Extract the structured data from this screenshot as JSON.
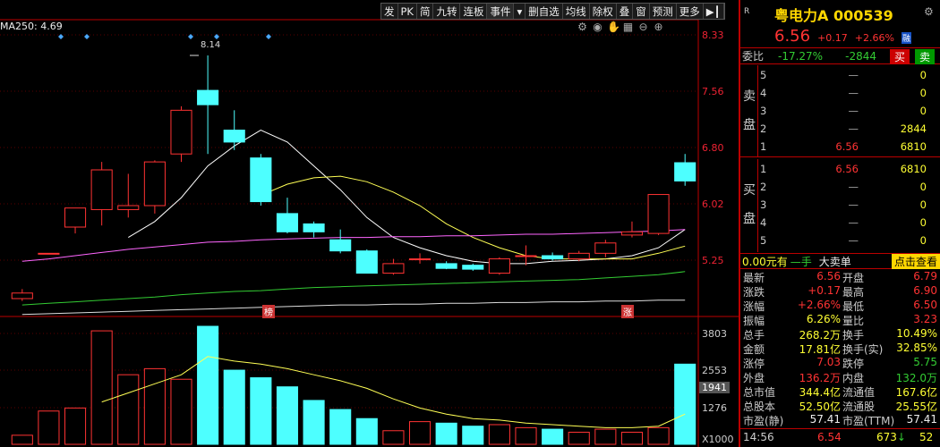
{
  "toolbar": [
    {
      "label": "发",
      "active": false
    },
    {
      "label": "PK",
      "active": false
    },
    {
      "label": "简",
      "active": false
    },
    {
      "label": "九转",
      "active": false
    },
    {
      "label": "连板",
      "active": false
    },
    {
      "label": "事件",
      "active": true
    },
    {
      "label": "▾",
      "active": false
    },
    {
      "label": "删自选",
      "active": false
    },
    {
      "label": "均线",
      "active": false
    },
    {
      "label": "除权",
      "active": false
    },
    {
      "label": "叠",
      "active": false
    },
    {
      "label": "窗",
      "active": false
    },
    {
      "label": "预测",
      "active": false
    },
    {
      "label": "更多",
      "active": false
    },
    {
      "label": "▶┃",
      "active": false
    }
  ],
  "ma_label": "MA250: 4.69",
  "price_axis": [
    "8.33",
    "7.56",
    "6.80",
    "6.02",
    "5.25"
  ],
  "volume_axis": [
    "3803",
    "2553",
    "1276",
    "X1000"
  ],
  "volume_badge": "1941",
  "annotations": {
    "high": "8.14",
    "mark1": "榜",
    "mark2": "涨"
  },
  "colors": {
    "up": "#ff3333",
    "down": "#4dffff",
    "ma5": "#ffffff",
    "ma10": "#ffff55",
    "ma20": "#ff66ff",
    "ma60": "#33cc33",
    "ma250": "#dddddd"
  },
  "chart_data": {
    "type": "candlestick",
    "ylim": [
      4.9,
      8.5
    ],
    "vol_ylim": [
      0,
      3900
    ],
    "candles": [
      {
        "o": 5.08,
        "c": 5.15,
        "h": 5.2,
        "l": 5.05,
        "v": 300
      },
      {
        "o": 5.65,
        "c": 5.65,
        "h": 5.65,
        "l": 5.65,
        "v": 1100
      },
      {
        "o": 5.98,
        "c": 6.22,
        "h": 6.22,
        "l": 5.9,
        "v": 1200
      },
      {
        "o": 6.2,
        "c": 6.7,
        "h": 6.8,
        "l": 6.0,
        "v": 3750
      },
      {
        "o": 6.2,
        "c": 6.25,
        "h": 6.65,
        "l": 6.1,
        "v": 2300
      },
      {
        "o": 6.25,
        "c": 6.8,
        "h": 6.82,
        "l": 6.15,
        "v": 2500
      },
      {
        "o": 6.9,
        "c": 7.45,
        "h": 7.5,
        "l": 6.8,
        "v": 2150
      },
      {
        "o": 7.7,
        "c": 7.52,
        "h": 8.14,
        "l": 6.9,
        "v": 3900
      },
      {
        "o": 7.2,
        "c": 7.05,
        "h": 7.45,
        "l": 6.95,
        "v": 2450
      },
      {
        "o": 6.85,
        "c": 6.3,
        "h": 6.9,
        "l": 6.25,
        "v": 2200
      },
      {
        "o": 6.15,
        "c": 5.92,
        "h": 6.35,
        "l": 5.9,
        "v": 1900
      },
      {
        "o": 6.02,
        "c": 5.92,
        "h": 6.05,
        "l": 5.85,
        "v": 1450
      },
      {
        "o": 5.82,
        "c": 5.68,
        "h": 5.95,
        "l": 5.65,
        "v": 1150
      },
      {
        "o": 5.68,
        "c": 5.4,
        "h": 5.7,
        "l": 5.4,
        "v": 850
      },
      {
        "o": 5.4,
        "c": 5.52,
        "h": 5.58,
        "l": 5.38,
        "v": 450
      },
      {
        "o": 5.58,
        "c": 5.58,
        "h": 5.65,
        "l": 5.52,
        "v": 750
      },
      {
        "o": 5.52,
        "c": 5.46,
        "h": 5.55,
        "l": 5.45,
        "v": 700
      },
      {
        "o": 5.5,
        "c": 5.45,
        "h": 5.52,
        "l": 5.43,
        "v": 600
      },
      {
        "o": 5.4,
        "c": 5.58,
        "h": 5.6,
        "l": 5.38,
        "v": 650
      },
      {
        "o": 5.62,
        "c": 5.62,
        "h": 5.75,
        "l": 5.5,
        "v": 550
      },
      {
        "o": 5.62,
        "c": 5.58,
        "h": 5.66,
        "l": 5.56,
        "v": 500
      },
      {
        "o": 5.58,
        "c": 5.65,
        "h": 5.68,
        "l": 5.55,
        "v": 400
      },
      {
        "o": 5.65,
        "c": 5.78,
        "h": 5.82,
        "l": 5.6,
        "v": 500
      },
      {
        "o": 5.88,
        "c": 5.92,
        "h": 6.05,
        "l": 5.85,
        "v": 400
      },
      {
        "o": 5.9,
        "c": 6.39,
        "h": 6.39,
        "l": 5.88,
        "v": 550
      },
      {
        "o": 6.79,
        "c": 6.56,
        "h": 6.9,
        "l": 6.5,
        "v": 2650
      }
    ],
    "ma_series": [
      {
        "key": "ma5",
        "values": [
          null,
          null,
          null,
          null,
          5.85,
          6.05,
          6.35,
          6.75,
          7.0,
          7.2,
          7.05,
          6.75,
          6.45,
          6.1,
          5.85,
          5.72,
          5.62,
          5.55,
          5.52,
          5.52,
          5.55,
          5.56,
          5.58,
          5.62,
          5.72,
          5.95
        ]
      },
      {
        "key": "ma10",
        "values": [
          null,
          null,
          null,
          null,
          null,
          null,
          null,
          null,
          null,
          6.38,
          6.52,
          6.6,
          6.62,
          6.55,
          6.42,
          6.25,
          6.02,
          5.85,
          5.72,
          5.62,
          5.58,
          5.58,
          5.58,
          5.58,
          5.65,
          5.74
        ]
      },
      {
        "key": "ma20",
        "values": [
          5.55,
          5.58,
          5.62,
          5.66,
          5.7,
          5.73,
          5.76,
          5.79,
          5.8,
          5.82,
          5.83,
          5.84,
          5.85,
          5.85,
          5.86,
          5.86,
          5.87,
          5.87,
          5.88,
          5.89,
          5.89,
          5.9,
          5.91,
          5.92,
          5.93,
          5.95
        ]
      },
      {
        "key": "ma60",
        "values": [
          5.0,
          5.02,
          5.04,
          5.06,
          5.08,
          5.1,
          5.13,
          5.15,
          5.17,
          5.18,
          5.2,
          5.22,
          5.23,
          5.24,
          5.25,
          5.26,
          5.27,
          5.28,
          5.29,
          5.3,
          5.31,
          5.32,
          5.34,
          5.36,
          5.38,
          5.42
        ]
      },
      {
        "key": "ma250",
        "values": [
          4.88,
          4.89,
          4.9,
          4.91,
          4.92,
          4.93,
          4.94,
          4.95,
          4.96,
          4.97,
          4.98,
          4.99,
          5.0,
          5.0,
          5.01,
          5.01,
          5.02,
          5.02,
          5.03,
          5.03,
          5.04,
          5.04,
          5.05,
          5.05,
          5.06,
          5.06
        ]
      }
    ],
    "vol_ma": [
      null,
      null,
      null,
      1400,
      1700,
      2000,
      2300,
      2900,
      2750,
      2650,
      2500,
      2300,
      2100,
      1850,
      1500,
      1200,
      1000,
      850,
      800,
      700,
      650,
      600,
      550,
      550,
      600,
      1000
    ]
  },
  "quote": {
    "title": "粤电力A 000539",
    "price": "6.56",
    "change": "+0.17",
    "pct": "+2.66%",
    "rong": "融",
    "weibi_label": "委比",
    "weibi_pct": "-17.27%",
    "weibi_val": "-2844",
    "buy_label": "买",
    "sell_label": "卖",
    "sell_side": "卖盘",
    "buy_side": "买盘",
    "asks": [
      {
        "lv": "5",
        "price": "—",
        "vol": "0"
      },
      {
        "lv": "4",
        "price": "—",
        "vol": "0"
      },
      {
        "lv": "3",
        "price": "—",
        "vol": "0"
      },
      {
        "lv": "2",
        "price": "—",
        "vol": "2844"
      },
      {
        "lv": "1",
        "price": "6.56",
        "vol": "6810"
      }
    ],
    "bids": [
      {
        "lv": "1",
        "price": "6.56",
        "vol": "6810"
      },
      {
        "lv": "2",
        "price": "—",
        "vol": "0"
      },
      {
        "lv": "3",
        "price": "—",
        "vol": "0"
      },
      {
        "lv": "4",
        "price": "—",
        "vol": "0"
      },
      {
        "lv": "5",
        "price": "—",
        "vol": "0"
      }
    ],
    "dd_amount": "0.00元有",
    "dd_hand": "—手",
    "dd_label": "大卖单",
    "dd_link": "点击查看",
    "stats": [
      {
        "k1": "最新",
        "v1": "6.56",
        "c1": "red",
        "k2": "开盘",
        "v2": "6.79",
        "c2": "red"
      },
      {
        "k1": "涨跌",
        "v1": "+0.17",
        "c1": "red",
        "k2": "最高",
        "v2": "6.90",
        "c2": "red"
      },
      {
        "k1": "涨幅",
        "v1": "+2.66%",
        "c1": "red",
        "k2": "最低",
        "v2": "6.50",
        "c2": "red"
      },
      {
        "k1": "振幅",
        "v1": "6.26%",
        "c1": "yel",
        "k2": "量比",
        "v2": "3.23",
        "c2": "red"
      },
      {
        "k1": "总手",
        "v1": "268.2万",
        "c1": "yel",
        "k2": "换手",
        "v2": "10.49%",
        "c2": "yel"
      },
      {
        "k1": "金额",
        "v1": "17.81亿",
        "c1": "yel",
        "k2": "换手(实)",
        "v2": "32.85%",
        "c2": "yel"
      },
      {
        "k1": "涨停",
        "v1": "7.03",
        "c1": "red",
        "k2": "跌停",
        "v2": "5.75",
        "c2": "grn"
      },
      {
        "k1": "外盘",
        "v1": "136.2万",
        "c1": "red",
        "k2": "内盘",
        "v2": "132.0万",
        "c2": "grn"
      },
      {
        "k1": "总市值",
        "v1": "344.4亿",
        "c1": "yel",
        "k2": "流通值",
        "v2": "167.6亿",
        "c2": "yel"
      },
      {
        "k1": "总股本",
        "v1": "52.50亿",
        "c1": "yel",
        "k2": "流通股",
        "v2": "25.55亿",
        "c2": "yel"
      },
      {
        "k1": "市盈(静)",
        "v1": "57.41",
        "c1": "wht",
        "k2": "市盈(TTM)",
        "v2": "57.41",
        "c2": "wht"
      }
    ],
    "bottom": {
      "time": "14:56",
      "price": "6.54",
      "vol": "673",
      "arrow": "↓",
      "num": "52"
    }
  }
}
